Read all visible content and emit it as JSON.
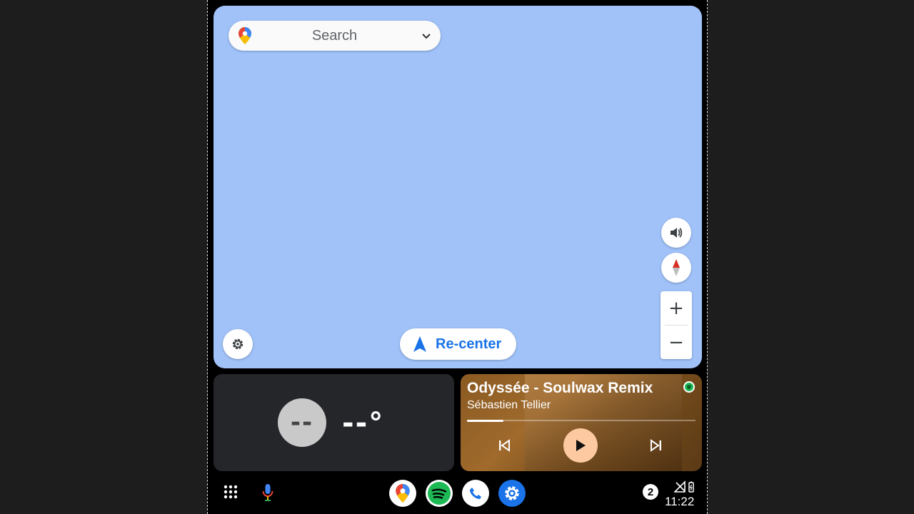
{
  "map": {
    "search_placeholder": "Search",
    "recenter_label": "Re-center",
    "zoom_in": "+",
    "zoom_out": "−"
  },
  "weather": {
    "icon_text": "--",
    "temperature": "--°"
  },
  "media": {
    "title": "Odyssée - Soulwax Remix",
    "artist": "Sébastien Tellier",
    "progress": 0.16
  },
  "taskbar": {
    "notification_count": "2",
    "time": "11:22"
  },
  "colors": {
    "map_bg": "#a0c2f9",
    "accent": "#1a73e8",
    "play_button": "#fdc9a0",
    "spotify": "#1db954"
  }
}
